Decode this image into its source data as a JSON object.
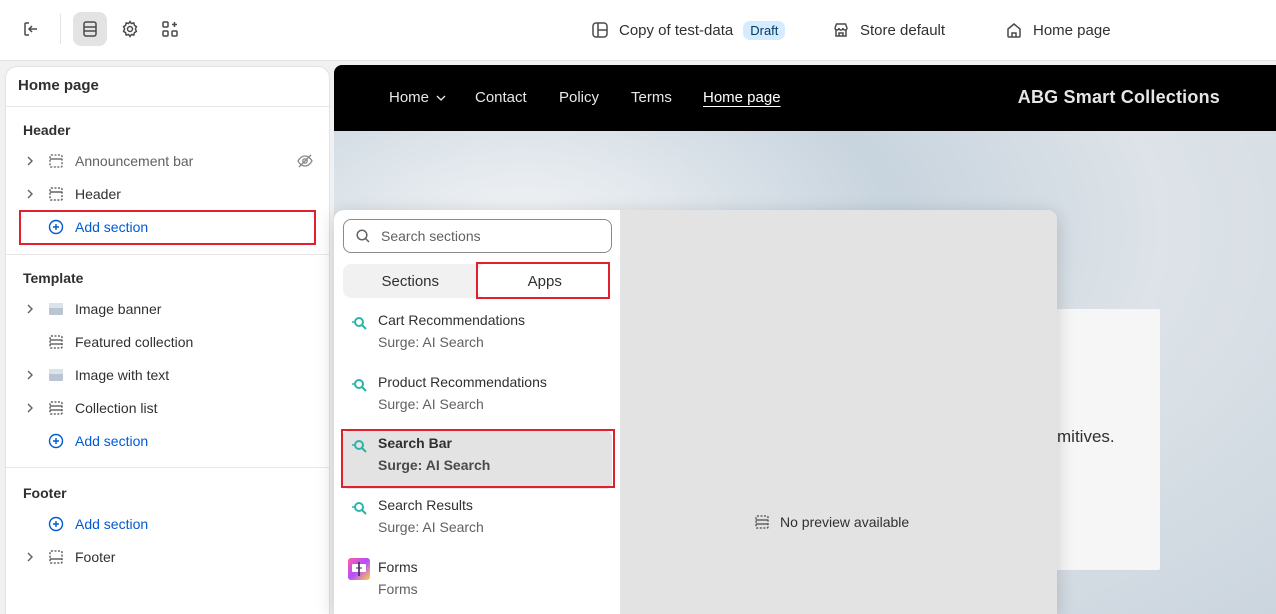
{
  "topbar": {
    "theme_name": "Copy of test-data",
    "theme_status": "Draft",
    "store": "Store default",
    "page": "Home page"
  },
  "sidebar": {
    "title": "Home page",
    "header_group": {
      "title": "Header",
      "items": [
        {
          "label": "Announcement bar",
          "hidden": true
        },
        {
          "label": "Header"
        }
      ],
      "add_label": "Add section"
    },
    "template_group": {
      "title": "Template",
      "items": [
        {
          "label": "Image banner"
        },
        {
          "label": "Featured collection"
        },
        {
          "label": "Image with text"
        },
        {
          "label": "Collection list"
        }
      ],
      "add_label": "Add section"
    },
    "footer_group": {
      "title": "Footer",
      "add_label": "Add section",
      "items": [
        {
          "label": "Footer"
        }
      ]
    }
  },
  "preview": {
    "nav": [
      "Home",
      "Contact",
      "Policy",
      "Terms",
      "Home page"
    ],
    "store_name": "ABG Smart Collections",
    "hero_text": "mitives."
  },
  "picker": {
    "search_placeholder": "Search sections",
    "tabs": [
      "Sections",
      "Apps"
    ],
    "active_tab": "Apps",
    "items": [
      {
        "name": "Cart Recommendations",
        "app": "Surge: AI Search"
      },
      {
        "name": "Product Recommendations",
        "app": "Surge: AI Search"
      },
      {
        "name": "Search Bar",
        "app": "Surge: AI Search",
        "selected": true
      },
      {
        "name": "Search Results",
        "app": "Surge: AI Search"
      },
      {
        "name": "Forms",
        "app": "Forms"
      }
    ],
    "no_preview": "No preview available"
  },
  "colors": {
    "accent": "#005bd3",
    "highlight_box": "#e0202c",
    "draft_badge": "#d5ebff"
  }
}
